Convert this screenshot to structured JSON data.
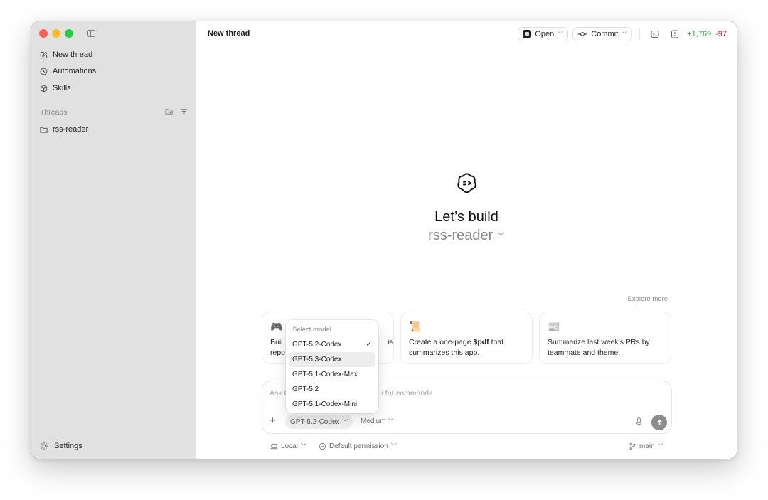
{
  "sidebar": {
    "nav": [
      {
        "label": "New thread",
        "icon": "edit-icon"
      },
      {
        "label": "Automations",
        "icon": "clock-icon"
      },
      {
        "label": "Skills",
        "icon": "cube-icon"
      }
    ],
    "section_label": "Threads",
    "threads": [
      {
        "label": "rss-reader",
        "icon": "folder-icon"
      }
    ],
    "settings_label": "Settings"
  },
  "header": {
    "title": "New thread",
    "open_label": "Open",
    "commit_label": "Commit",
    "diff_added": "+1,769",
    "diff_removed": "-97"
  },
  "hero": {
    "title": "Let’s build",
    "project": "rss-reader"
  },
  "explore_label": "Explore more",
  "cards": [
    {
      "emoji": "🎮",
      "text_visible_start": "Buil",
      "text_visible_line2": "repo",
      "text_visible_end": "is"
    },
    {
      "emoji": "📜",
      "text_prefix": "Create a one-page ",
      "text_bold": "$pdf",
      "text_suffix": " that summarizes this app."
    },
    {
      "emoji": "📰",
      "text": "Summarize last week's PRs by teammate and theme."
    }
  ],
  "composer": {
    "placeholder_start": "Ask C",
    "placeholder_end": "es, / for commands",
    "model": "GPT-5.2-Codex",
    "effort": "Medium"
  },
  "model_menu": {
    "header": "Select model",
    "items": [
      {
        "label": "GPT-5.2-Codex",
        "checked": true,
        "highlighted": false
      },
      {
        "label": "GPT-5.3-Codex",
        "checked": false,
        "highlighted": true
      },
      {
        "label": "GPT-5.1-Codex-Max",
        "checked": false,
        "highlighted": false
      },
      {
        "label": "GPT-5.2",
        "checked": false,
        "highlighted": false
      },
      {
        "label": "GPT-5.1-Codex-Mini",
        "checked": false,
        "highlighted": false
      }
    ],
    "check_glyph": "✓"
  },
  "footer": {
    "location": "Local",
    "permission": "Default permission",
    "branch": "main"
  },
  "colors": {
    "sidebar_bg": "#e1e1e1",
    "diff_add": "#2ea043",
    "diff_del": "#d1242f"
  }
}
